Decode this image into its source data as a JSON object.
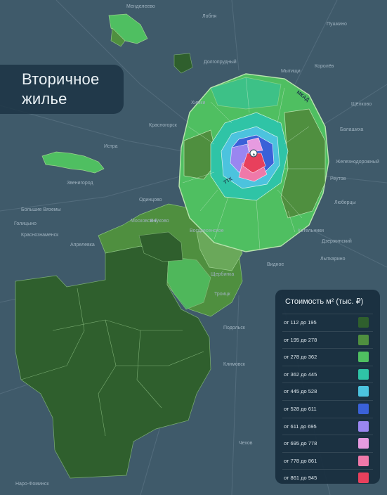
{
  "title": {
    "line1": "Вторичное",
    "line2": "жилье"
  },
  "map_labels": [
    "Менделеево",
    "Лобня",
    "Пушкино",
    "Долгопрудный",
    "Мытищи",
    "Королёв",
    "Химки",
    "Щёлково",
    "Красногорск",
    "Балашиха",
    "Железнодорожный",
    "Истра",
    "Звенигород",
    "Одинцово",
    "Реутов",
    "Люберцы",
    "Дзержинский",
    "Котельники",
    "Лыткарино",
    "Видное",
    "Апрелевка",
    "Голицыно",
    "Краснознаменск",
    "Троицк",
    "Подольск",
    "Климовск",
    "Щербинка",
    "Воскресенское",
    "Наро-Фоминск",
    "Большие Вяземы",
    "Внуково",
    "Московский",
    "Чехов"
  ],
  "road_labels": {
    "mkad": "МКАД",
    "ttk": "ТТК"
  },
  "legend": {
    "title": "Стоимость м² (тыс. ₽)",
    "items": [
      {
        "label": "от 112 до 195",
        "color": "#2f5f2d"
      },
      {
        "label": "от 195 до 278",
        "color": "#4f8f3f"
      },
      {
        "label": "от 278 до 362",
        "color": "#4fbf61"
      },
      {
        "label": "от 362 до 445",
        "color": "#2fc4a6"
      },
      {
        "label": "от 445 до 528",
        "color": "#4cc3de"
      },
      {
        "label": "от 528 до 611",
        "color": "#3a61d8"
      },
      {
        "label": "от 611 до 695",
        "color": "#9a86f0"
      },
      {
        "label": "от 695 до 778",
        "color": "#e69be0"
      },
      {
        "label": "от 778 до 861",
        "color": "#ef79a9"
      },
      {
        "label": "от 861 до 945",
        "color": "#e8405c"
      }
    ]
  }
}
